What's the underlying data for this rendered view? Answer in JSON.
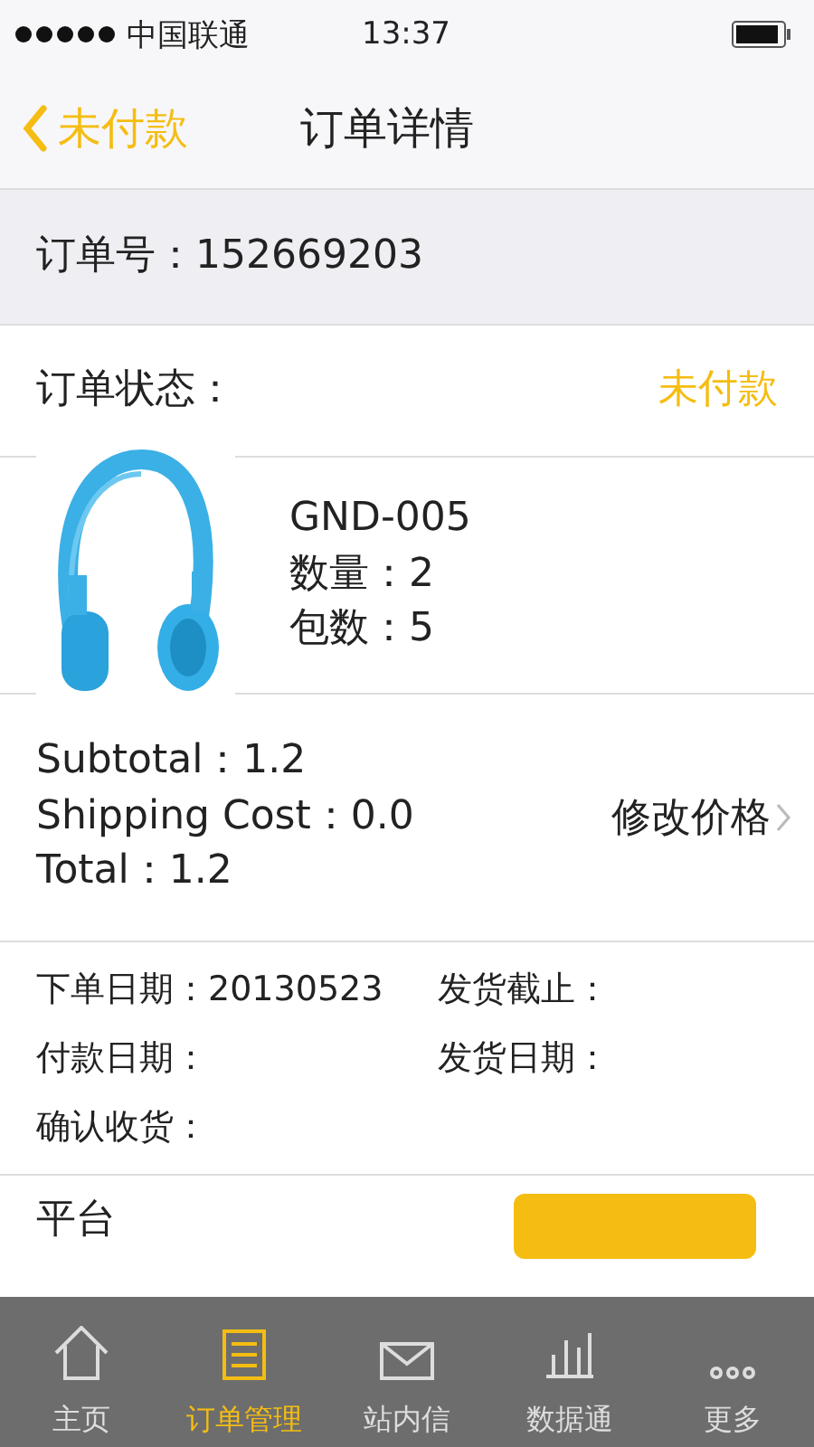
{
  "status_bar": {
    "carrier": "中国联通",
    "time": "13:37"
  },
  "nav": {
    "back": "未付款",
    "title": "订单详情"
  },
  "order_number": {
    "label": "订单号：",
    "value": "152669203"
  },
  "order_status": {
    "label": "订单状态：",
    "value": "未付款"
  },
  "product": {
    "model": "GND-005",
    "quantity": "数量：2",
    "packages": "包数：5"
  },
  "prices": {
    "lines": [
      "Subtotal：1.2",
      "Shipping Cost：0.0",
      "Total：1.2"
    ],
    "edit": "修改价格"
  },
  "dates": [
    {
      "label": "下单日期：",
      "value": "20130523"
    },
    {
      "label": "发货截止："
    },
    {
      "label": "付款日期："
    },
    {
      "label": "发货日期："
    },
    {
      "label": "确认收货："
    }
  ],
  "footer_row": {
    "label": "平台"
  },
  "tabs": [
    {
      "label": "主页",
      "selected": false
    },
    {
      "label": "订单管理",
      "selected": true
    },
    {
      "label": "站内信",
      "selected": false
    },
    {
      "label": "数据通",
      "selected": false
    },
    {
      "label": "更多",
      "selected": false
    }
  ]
}
